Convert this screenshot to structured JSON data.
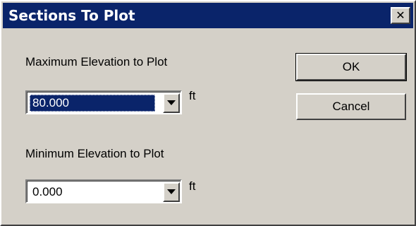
{
  "window": {
    "title": "Sections To Plot",
    "close_glyph": "✕",
    "colors": {
      "titlebar": "#0a246a",
      "face": "#d4d0c8",
      "selection": "#0a246a"
    }
  },
  "max_elevation": {
    "label": "Maximum Elevation to Plot",
    "value": "80.000",
    "unit": "ft",
    "selected": true,
    "dropdown_icon": "chevron-down-icon"
  },
  "min_elevation": {
    "label": "Minimum Elevation to Plot",
    "value": "0.000",
    "unit": "ft",
    "selected": false,
    "dropdown_icon": "chevron-down-icon"
  },
  "buttons": {
    "ok": "OK",
    "cancel": "Cancel"
  }
}
